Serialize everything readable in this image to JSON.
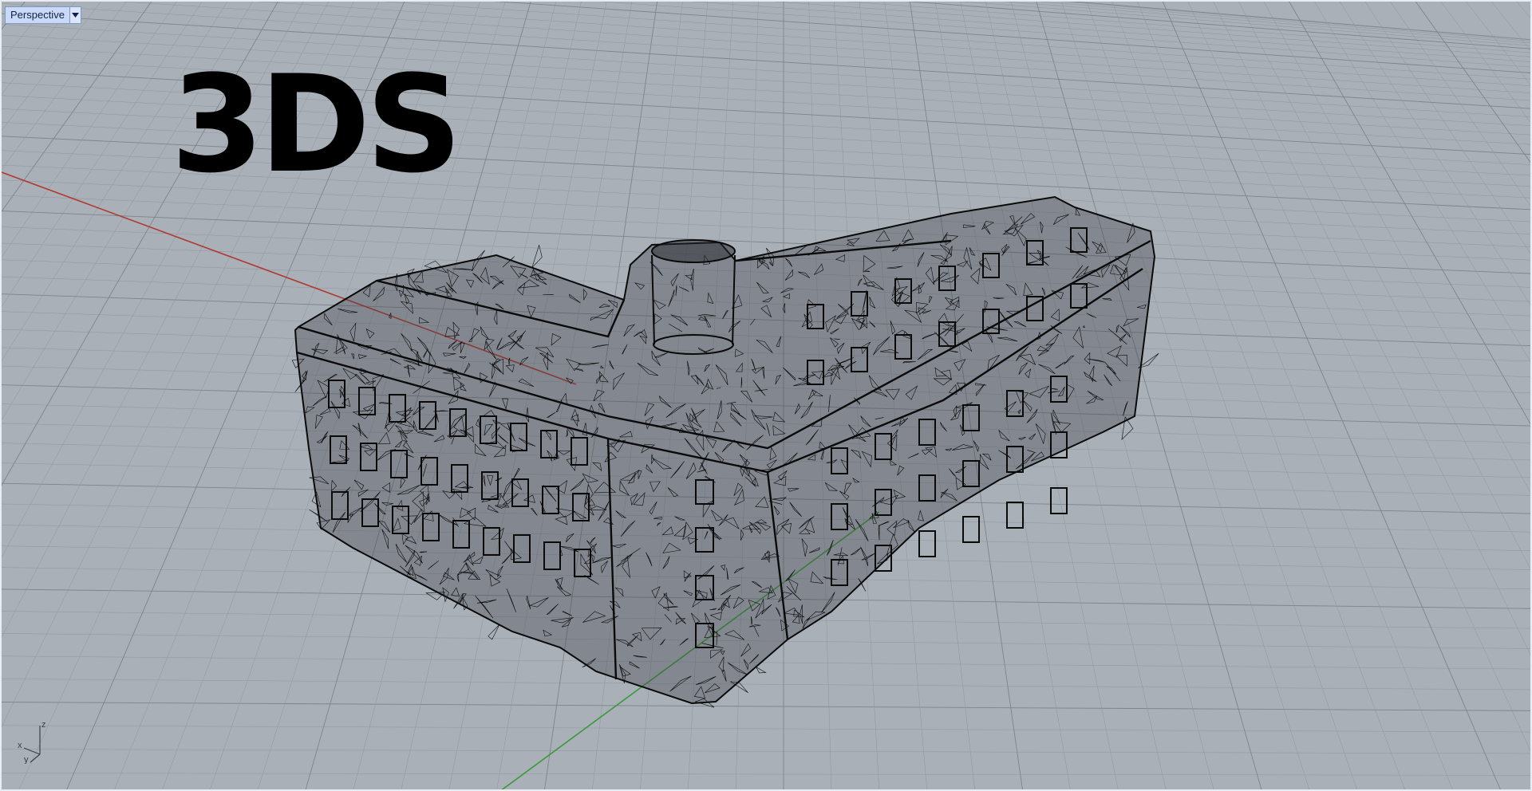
{
  "viewport": {
    "tab_label": "Perspective",
    "tab_menu_icon": "chevron-down-icon",
    "overlay_text": "3DS",
    "axes": {
      "x": "x",
      "y": "y",
      "z": "z"
    },
    "background_color": "#a9b0b8",
    "grid_color": "#8e959d",
    "major_grid_color": "#7d848c",
    "x_axis_color": "#b03a32",
    "y_axis_color": "#3a9a3a",
    "model_wire_color": "#0a0a0a"
  }
}
